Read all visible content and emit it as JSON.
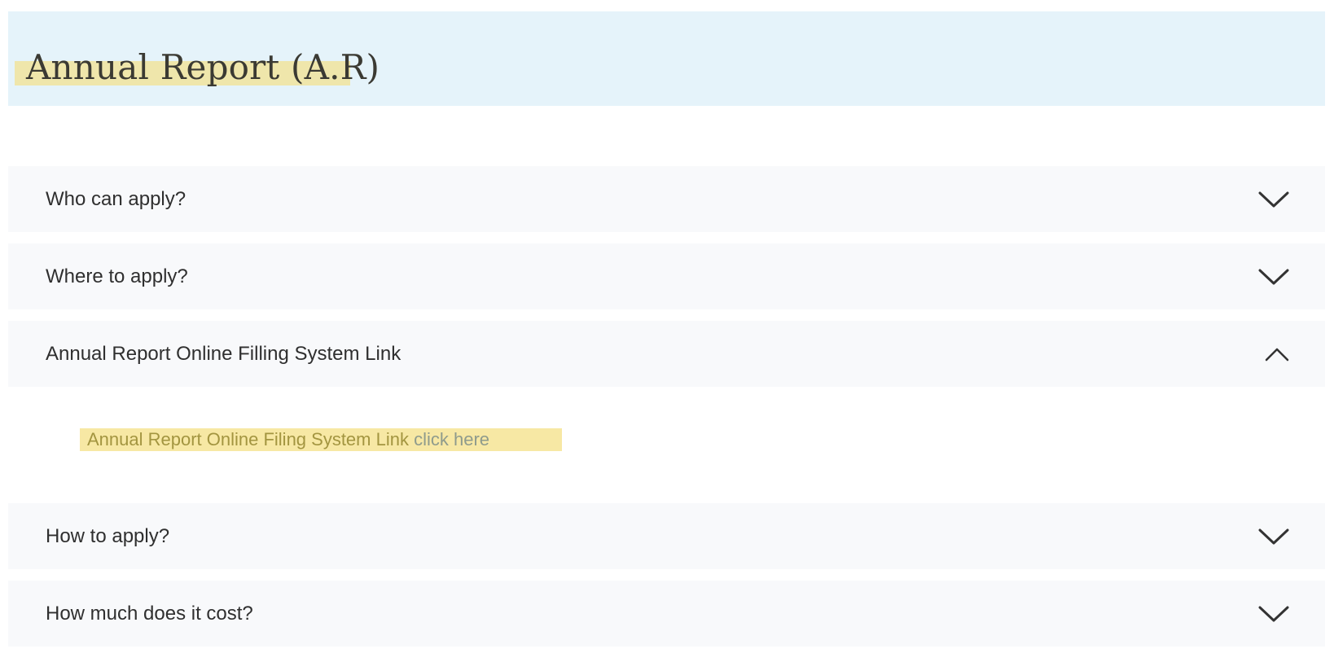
{
  "header": {
    "title": "Annual Report (A.R)"
  },
  "accordion": {
    "items": [
      {
        "label": "Who can apply?",
        "expanded": false,
        "icon": "chevron-down-icon"
      },
      {
        "label": "Where to apply?",
        "expanded": false,
        "icon": "chevron-down-icon"
      },
      {
        "label": "Annual Report Online Filling System Link",
        "expanded": true,
        "icon": "chevron-up-icon"
      },
      {
        "label": "How to apply?",
        "expanded": false,
        "icon": "chevron-down-icon"
      },
      {
        "label": "How much does it cost?",
        "expanded": false,
        "icon": "chevron-down-icon"
      }
    ],
    "panel": {
      "text": "Annual Report Online Filing System Link ",
      "link_label": "click here"
    }
  },
  "colors": {
    "header_bg": "#e5f3fa",
    "highlight": "#f1e39c",
    "item_bg": "#f8f9fb",
    "text": "#2f2f2f"
  }
}
